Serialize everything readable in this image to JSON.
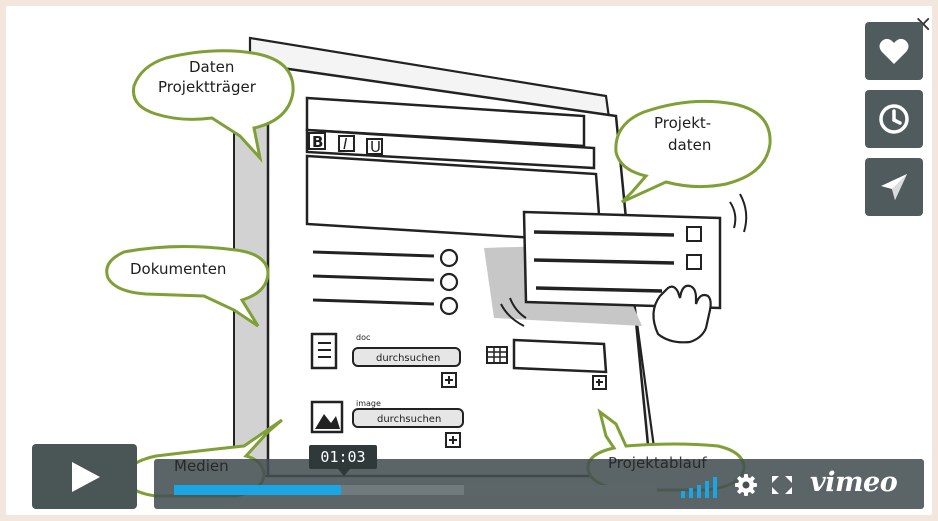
{
  "illustration": {
    "bubbles": {
      "daten_line1": "Daten",
      "daten_line2": "Projektträger",
      "projekt_line1": "Projekt-",
      "projekt_line2": "daten",
      "dokumenten": "Dokumenten",
      "medien": "Medien",
      "projektablauf": "Projektablauf"
    },
    "form": {
      "format_bold": "B",
      "format_italic": "I",
      "format_underline": "U",
      "doc_label": "doc",
      "doc_button": "durchsuchen",
      "image_label": "image",
      "image_button": "durchsuchen"
    }
  },
  "side_actions": {
    "like": "heart-icon",
    "watch_later": "clock-icon",
    "share": "paper-plane-icon"
  },
  "close_symbol": "×",
  "player": {
    "play_icon": "play-icon",
    "timecode": "01:03",
    "progress_fraction": 0.345,
    "accent_color": "#1aa6e5",
    "brand": "vimeo"
  }
}
